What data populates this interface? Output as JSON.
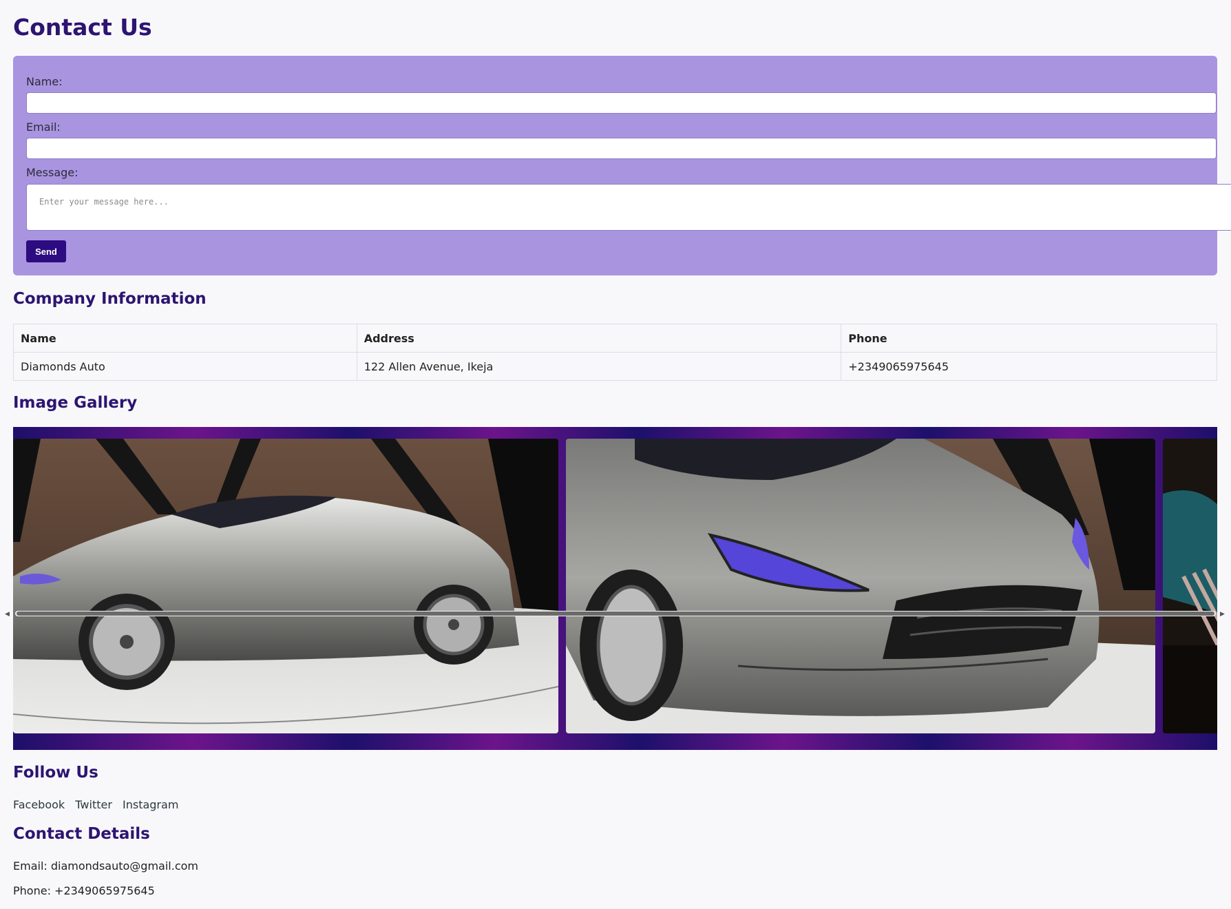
{
  "page": {
    "title": "Contact Us"
  },
  "contact_form": {
    "name_label": "Name:",
    "name_value": "",
    "email_label": "Email:",
    "email_value": "",
    "message_label": "Message:",
    "message_placeholder": "Enter your message here...",
    "send_label": "Send"
  },
  "company_info": {
    "title": "Company Information",
    "headers": [
      "Name",
      "Address",
      "Phone"
    ],
    "rows": [
      [
        "Diamonds Auto",
        "122 Allen Avenue, Ikeja",
        "+2349065975645"
      ]
    ]
  },
  "gallery": {
    "title": "Image Gallery",
    "images": [
      "silver-sports-car-side-photo",
      "silver-sports-car-front-photo",
      "partial-car-photo"
    ]
  },
  "follow": {
    "title": "Follow Us",
    "links": [
      "Facebook",
      "Twitter",
      "Instagram"
    ]
  },
  "contact_details": {
    "title": "Contact Details",
    "email": "Email: diamondsauto@gmail.com",
    "phone": "Phone: +2349065975645"
  },
  "colors": {
    "heading": "#2d1470",
    "form_panel": "#a994e0",
    "send_button": "#2d0b80",
    "page_background": "#f8f8fb"
  }
}
